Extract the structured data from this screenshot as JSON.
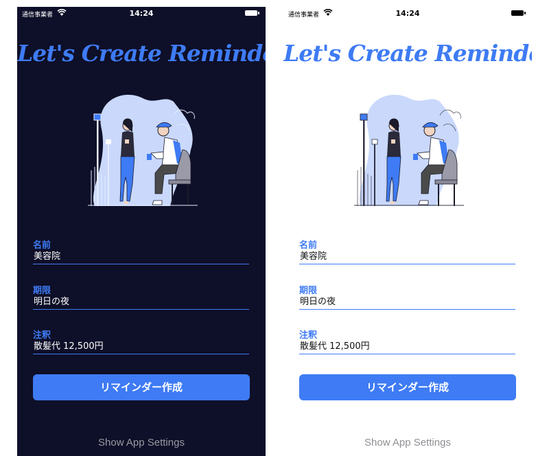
{
  "screens": [
    {
      "theme": "dark",
      "status": {
        "carrier": "通信事業者",
        "time": "14:24"
      },
      "title": "Let's Create Reminders.",
      "fields": [
        {
          "label": "名前",
          "value": "美容院"
        },
        {
          "label": "期限",
          "value": "明日の夜"
        },
        {
          "label": "注釈",
          "value": "散髪代 12,500円"
        }
      ],
      "button": "リマインダー作成",
      "settings_link": "Show App Settings"
    },
    {
      "theme": "light",
      "status": {
        "carrier": "通信事業者",
        "time": "14:24"
      },
      "title": "Let's Create Reminders.",
      "fields": [
        {
          "label": "名前",
          "value": "美容院"
        },
        {
          "label": "期限",
          "value": "明日の夜"
        },
        {
          "label": "注釈",
          "value": "散髪代 12,500円"
        }
      ],
      "button": "リマインダー作成",
      "settings_link": "Show App Settings"
    }
  ],
  "colors": {
    "accent": "#3e7bf4",
    "dark_bg": "#0e0f28",
    "light_bg": "#ffffff",
    "blob_light": "#c9d8fb"
  },
  "icons": [
    "wifi-icon",
    "battery-icon",
    "couple-phones-illustration"
  ]
}
